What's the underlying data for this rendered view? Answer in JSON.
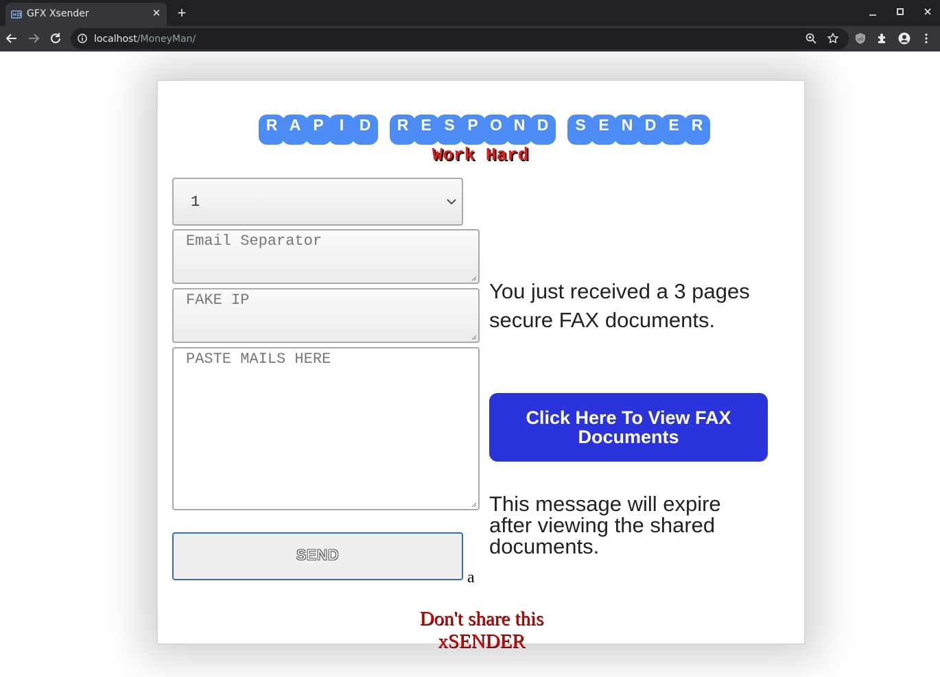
{
  "browser": {
    "tab_title": "GFX Xsender",
    "url_host": "localhost",
    "url_path": "/MoneyMan/"
  },
  "header": {
    "title_words": [
      [
        "R",
        "A",
        "P",
        "I",
        "D"
      ],
      [
        "R",
        "E",
        "S",
        "P",
        "O",
        "N",
        "D"
      ],
      [
        "S",
        "E",
        "N",
        "D",
        "E",
        "R"
      ]
    ],
    "subtitle": "Work Hard"
  },
  "form": {
    "select_value": "1",
    "separator_placeholder": "Email Separator",
    "fake_ip_placeholder": "FAKE IP",
    "mails_placeholder": "PASTE MAILS HERE",
    "send_label": "SEND",
    "stray_text": "a"
  },
  "preview": {
    "message": "You just received a 3 pages secure FAX documents.",
    "button_label": "Click Here To View FAX Documents",
    "expire_message": "This message will expire after viewing the shared documents."
  },
  "footer": {
    "text": "Don't share this xSENDER"
  },
  "colors": {
    "accent_blue": "#4d8cf5",
    "button_blue": "#2b34db",
    "alert_red": "#e11f1f"
  }
}
